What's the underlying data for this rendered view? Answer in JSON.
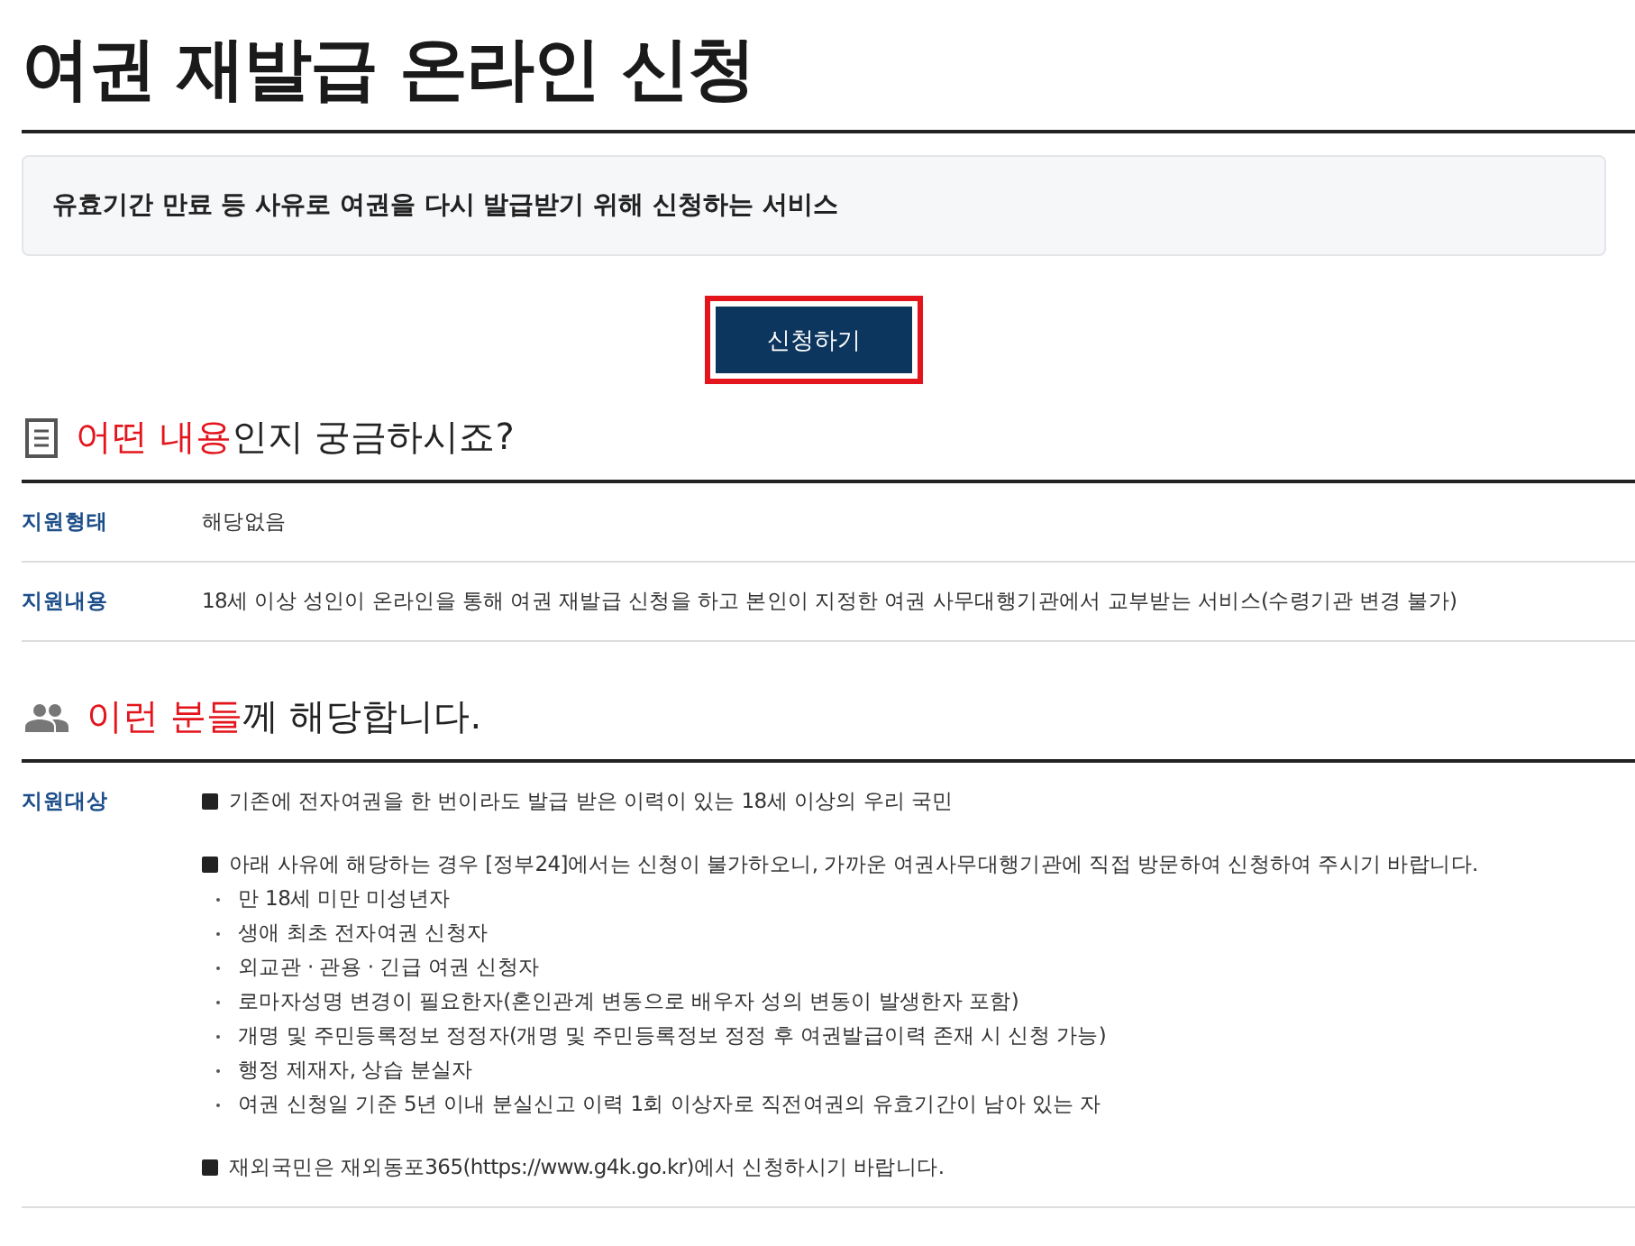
{
  "title": "여권 재발급 온라인 신청",
  "summary": "유효기간 만료 등 사유로 여권을 다시 발급받기 위해 신청하는 서비스",
  "apply_button": "신청하기",
  "sections": [
    {
      "kind": "document",
      "heading_highlight": "어떤 내용",
      "heading_rest": "인지 궁금하시죠?",
      "rows": [
        {
          "label": "지원형태",
          "items": [
            {
              "kind": "plain",
              "text": "해당없음"
            }
          ]
        },
        {
          "label": "지원내용",
          "items": [
            {
              "kind": "plain",
              "text": "18세 이상 성인이 온라인을 통해 여권 재발급 신청을 하고 본인이 지정한 여권 사무대행기관에서 교부받는 서비스(수령기관 변경 불가)"
            }
          ]
        }
      ]
    },
    {
      "kind": "people",
      "heading_highlight": "이런 분들",
      "heading_rest": "께 해당합니다.",
      "rows": [
        {
          "label": "지원대상",
          "items": [
            {
              "kind": "square",
              "text": "기존에 전자여권을 한 번이라도 발급 받은 이력이 있는 18세 이상의 우리 국민"
            },
            {
              "kind": "square",
              "text": "아래 사유에 해당하는 경우 [정부24]에서는 신청이 불가하오니, 가까운 여권사무대행기관에 직접 방문하여 신청하여 주시기 바랍니다.",
              "children": [
                "만 18세 미만 미성년자",
                "생애 최초 전자여권 신청자",
                "외교관 · 관용 · 긴급 여권 신청자",
                "로마자성명 변경이 필요한자(혼인관계 변동으로 배우자 성의 변동이 발생한자 포함)",
                "개명 및 주민등록정보 정정자(개명 및 주민등록정보 정정 후 여권발급이력 존재 시 신청 가능)",
                "행정 제재자, 상습 분실자",
                "여권 신청일 기준 5년 이내 분실신고 이력 1회 이상자로 직전여권의 유효기간이 남아 있는 자"
              ]
            },
            {
              "kind": "square",
              "text": "재외국민은 재외동포365(https://www.g4k.go.kr)에서 신청하시기 바랍니다."
            }
          ]
        }
      ]
    }
  ]
}
